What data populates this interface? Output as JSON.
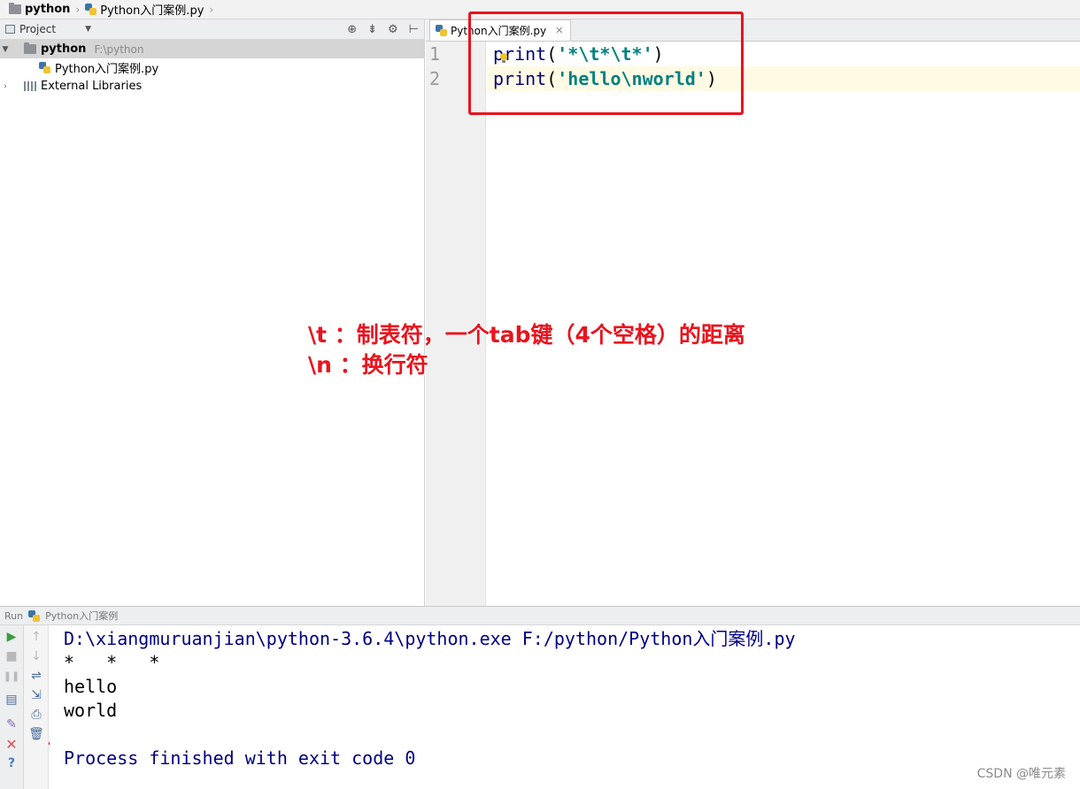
{
  "breadcrumb": {
    "project": "python",
    "file": "Python入门案例.py"
  },
  "project_panel": {
    "title": "Project",
    "root_name": "python",
    "root_path": "F:\\python",
    "file_item": "Python入门案例.py",
    "libraries": "External Libraries"
  },
  "editor": {
    "tab_label": "Python入门案例.py",
    "line_numbers": [
      "1",
      "2"
    ],
    "line1": {
      "kw": "print",
      "open": "(",
      "str": "'*\\t*\\t*'",
      "close": ")"
    },
    "line2": {
      "kw": "print",
      "open": "(",
      "str": "'hello\\nworld'",
      "close": ")"
    }
  },
  "annotation": {
    "line1": "\\t ：制表符，一个tab键（4个空格）的距离",
    "line2": "\\n ：换行符",
    "color": "#e8141e"
  },
  "run_panel": {
    "label": "Run",
    "config": "Python入门案例",
    "console": {
      "command": "D:\\xiangmuruanjian\\python-3.6.4\\python.exe F:/python/Python入门案例.py",
      "out1": "*   *   *",
      "out2": "hello",
      "out3": "world",
      "exit": "Process finished with exit code 0"
    }
  },
  "watermark": "CSDN @唯元素",
  "colors": {
    "keyword": "#000080",
    "string": "#008080",
    "current_line": "#fffae3"
  }
}
